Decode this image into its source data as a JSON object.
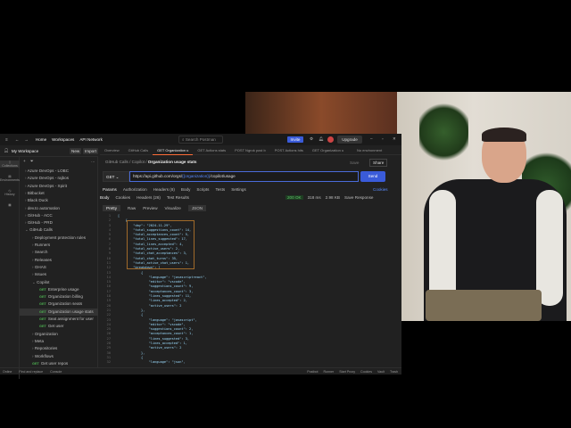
{
  "window": {
    "nav": [
      "Home",
      "Workspaces",
      "API Network"
    ],
    "search_placeholder": "Search Postman",
    "invite": "Invite",
    "upgrade": "Upgrade"
  },
  "rail": [
    "Collections",
    "Environments",
    "History",
    "Flows"
  ],
  "sidebar": {
    "workspace": "My Workspace",
    "new": "New",
    "import": "Import",
    "items": [
      {
        "label": "Azure DevOps - LOBC",
        "level": 0
      },
      {
        "label": "Azure DevOps - rajbos",
        "level": 0
      },
      {
        "label": "Azure DevOps - Xpirit",
        "level": 0
      },
      {
        "label": "Bitbucket",
        "level": 0
      },
      {
        "label": "Black Duck",
        "level": 0
      },
      {
        "label": "dev.to automation",
        "level": 0
      },
      {
        "label": "GitHub - ACC",
        "level": 0
      },
      {
        "label": "GitHub - PRD",
        "level": 0
      },
      {
        "label": "GitHub Calls",
        "level": 0
      },
      {
        "label": "Deployment protection rules",
        "level": 1
      },
      {
        "label": "Runners",
        "level": 1
      },
      {
        "label": "Search",
        "level": 1
      },
      {
        "label": "Releases",
        "level": 1
      },
      {
        "label": "GHAS",
        "level": 1
      },
      {
        "label": "Issues",
        "level": 1
      },
      {
        "label": "Copilot",
        "level": 1
      },
      {
        "label": "Enterprise usage",
        "level": 2,
        "method": "GET"
      },
      {
        "label": "Organization billing",
        "level": 2,
        "method": "GET"
      },
      {
        "label": "Organization seats",
        "level": 2,
        "method": "GET"
      },
      {
        "label": "Organization usage stats",
        "level": 2,
        "method": "GET",
        "selected": true
      },
      {
        "label": "Seat assignment for user",
        "level": 2,
        "method": "GET"
      },
      {
        "label": "Get user",
        "level": 2,
        "method": "GET"
      },
      {
        "label": "Organization",
        "level": 1
      },
      {
        "label": "Meta",
        "level": 1
      },
      {
        "label": "Repositories",
        "level": 1
      },
      {
        "label": "Workflows",
        "level": 1
      },
      {
        "label": "Get user repos",
        "level": 1,
        "method": "GET"
      }
    ]
  },
  "tabs": [
    "Overview",
    "GitHub Calls",
    "GET Organization u",
    "GET Actions stats",
    "POST Ngrok post b",
    "POST Actions hits",
    "GET Organization u"
  ],
  "environment": "No environment",
  "breadcrumb": {
    "p1": "GitHub Calls",
    "p2": "Copilot",
    "current": "Organization usage stats"
  },
  "save": "Save",
  "share": "Share",
  "request": {
    "method": "GET",
    "url_prefix": "https://api.github.com/orgs/",
    "url_var": "{{organization}}",
    "url_suffix": "/copilot/usage",
    "send": "Send"
  },
  "req_tabs": [
    "Params",
    "Authorization",
    "Headers (8)",
    "Body",
    "Scripts",
    "Tests",
    "Settings"
  ],
  "cookies": "Cookies",
  "resp_tabs": [
    "Body",
    "Cookies",
    "Headers (26)",
    "Test Results"
  ],
  "response": {
    "status": "200 OK",
    "time": "318 ms",
    "size": "2.98 KB",
    "save": "Save Response"
  },
  "view_tabs": [
    "Pretty",
    "Raw",
    "Preview",
    "Visualize"
  ],
  "format": "JSON",
  "code": [
    "[",
    "    {",
    "        \"day\": \"2024-11-29\",",
    "        \"total_suggestions_count\": 14,",
    "        \"total_acceptances_count\": 5,",
    "        \"total_lines_suggested\": 17,",
    "        \"total_lines_accepted\": 4,",
    "        \"total_active_users\": 2,",
    "        \"total_chat_acceptances\": 3,",
    "        \"total_chat_turns\": 35,",
    "        \"total_active_chat_users\": 1,",
    "        \"breakdown\": [",
    "            {",
    "                \"language\": \"javascriptreact\",",
    "                \"editor\": \"vscode\",",
    "                \"suggestions_count\": 9,",
    "                \"acceptances_count\": 3,",
    "                \"lines_suggested\": 11,",
    "                \"lines_accepted\": 2,",
    "                \"active_users\": 2",
    "            },",
    "            {",
    "                \"language\": \"javascript\",",
    "                \"editor\": \"vscode\",",
    "                \"suggestions_count\": 2,",
    "                \"acceptances_count\": 1,",
    "                \"lines_suggested\": 3,",
    "                \"lines_accepted\": 1,",
    "                \"active_users\": 2",
    "            },",
    "            {",
    "                \"language\": \"json\","
  ],
  "statusbar": {
    "left": [
      "Online",
      "Find and replace",
      "Console"
    ],
    "right": [
      "Postbot",
      "Runner",
      "Start Proxy",
      "Cookies",
      "Vault",
      "Trash"
    ]
  }
}
